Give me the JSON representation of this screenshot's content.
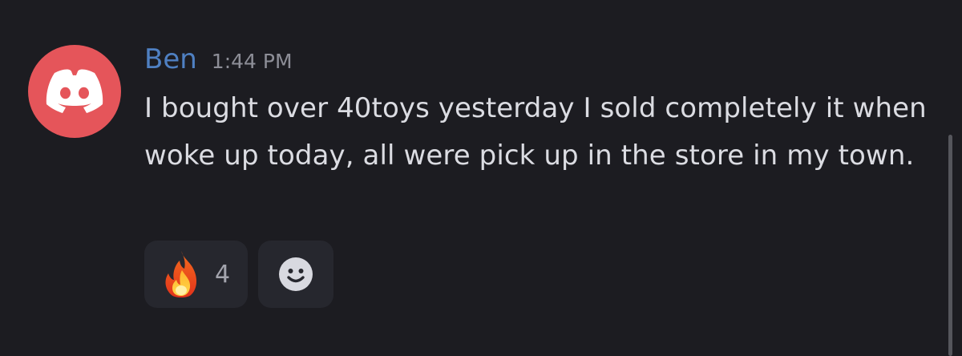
{
  "message": {
    "author": "Ben",
    "timestamp": "1:44 PM",
    "avatar_icon": "discord-logo-icon",
    "avatar_color": "#e5555a",
    "username_color": "#4f80c2",
    "text": "I bought over 40toys yesterday I sold completely it when woke up today, all were pick up in the store in my town."
  },
  "reactions": [
    {
      "emoji_icon": "fire-emoji-icon",
      "count": "4"
    }
  ],
  "add_reaction": {
    "icon": "smiley-face-icon"
  }
}
